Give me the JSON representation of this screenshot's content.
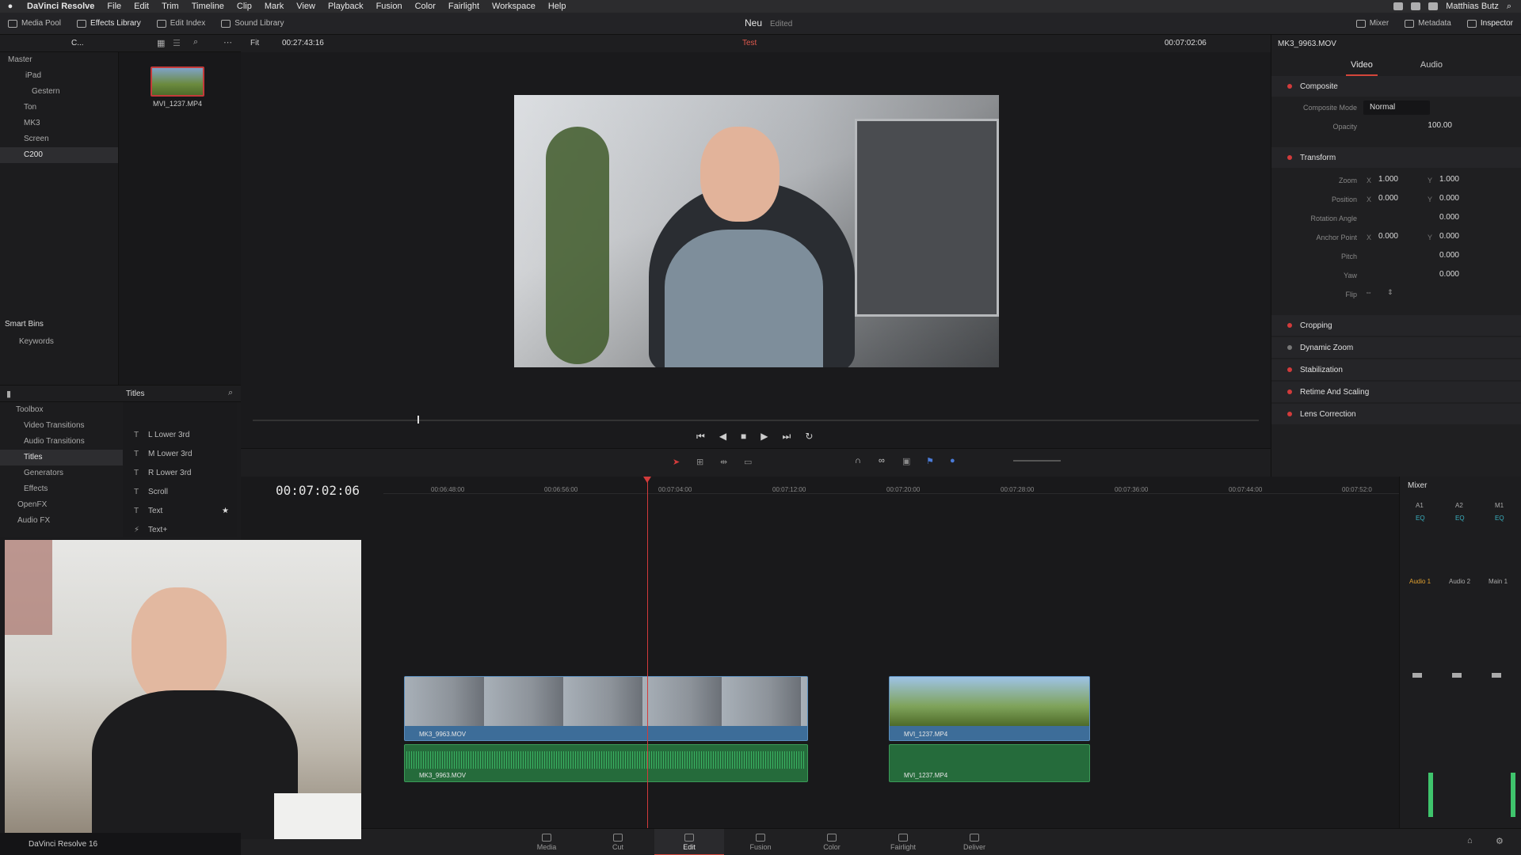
{
  "menubar": {
    "app": "DaVinci Resolve",
    "items": [
      "File",
      "Edit",
      "Trim",
      "Timeline",
      "Clip",
      "Mark",
      "View",
      "Playback",
      "Fusion",
      "Color",
      "Fairlight",
      "Workspace",
      "Help"
    ],
    "user": "Matthias Butz"
  },
  "toolbar": {
    "left": [
      "Media Pool",
      "Effects Library",
      "Edit Index",
      "Sound Library"
    ],
    "project": "Neu",
    "status": "Edited",
    "right": [
      "Mixer",
      "Metadata",
      "Inspector"
    ]
  },
  "pool": {
    "bin_label": "C...",
    "bins": [
      "Master",
      "iPad",
      "Gestern",
      "Ton",
      "MK3",
      "Screen",
      "C200"
    ],
    "clip_name": "MVI_1237.MP4",
    "smart_bins": "Smart Bins",
    "keywords": "Keywords"
  },
  "viewer": {
    "fit": "Fit",
    "timecode_src": "00:27:43:16",
    "timeline_name": "Test",
    "timecode_rec": "00:07:02:06"
  },
  "effects": {
    "tree": [
      "Toolbox",
      "Video Transitions",
      "Audio Transitions",
      "Titles",
      "Generators",
      "Effects",
      "OpenFX",
      "Audio FX"
    ],
    "list_title": "Titles",
    "list": [
      "L Lower 3rd",
      "M Lower 3rd",
      "R Lower 3rd",
      "Scroll",
      "Text",
      "Text+"
    ]
  },
  "inspector": {
    "clip": "MK3_9963.MOV",
    "tabs": [
      "Video",
      "Audio"
    ],
    "composite": {
      "title": "Composite",
      "mode_label": "Composite Mode",
      "mode": "Normal",
      "opacity_label": "Opacity",
      "opacity": "100.00"
    },
    "transform": {
      "title": "Transform",
      "zoom_label": "Zoom",
      "zoom_x": "1.000",
      "zoom_y": "1.000",
      "pos_label": "Position",
      "pos_x": "0.000",
      "pos_y": "0.000",
      "rot_label": "Rotation Angle",
      "rot": "0.000",
      "anchor_label": "Anchor Point",
      "anchor_x": "0.000",
      "anchor_y": "0.000",
      "pitch_label": "Pitch",
      "pitch": "0.000",
      "yaw_label": "Yaw",
      "yaw": "0.000",
      "flip_label": "Flip"
    },
    "sections": [
      "Cropping",
      "Dynamic Zoom",
      "Stabilization",
      "Retime And Scaling",
      "Lens Correction"
    ]
  },
  "timeline": {
    "timecode": "00:07:02:06",
    "ticks": [
      "00:06:48:00",
      "00:06:56:00",
      "00:07:04:00",
      "00:07:12:00",
      "00:07:20:00",
      "00:07:28:00",
      "00:07:36:00",
      "00:07:44:00",
      "00:07:52:0"
    ],
    "clips": [
      {
        "name": "MK3_9963.MOV"
      },
      {
        "name": "MVI_1237.MP4"
      }
    ]
  },
  "mixer": {
    "title": "Mixer",
    "channels": [
      "A1",
      "A2",
      "M1"
    ],
    "eq": "EQ",
    "names": [
      "Audio 1",
      "Audio 2",
      "Main 1"
    ]
  },
  "pages": [
    "Media",
    "Cut",
    "Edit",
    "Fusion",
    "Color",
    "Fairlight",
    "Deliver"
  ],
  "footer": "DaVinci Resolve 16"
}
